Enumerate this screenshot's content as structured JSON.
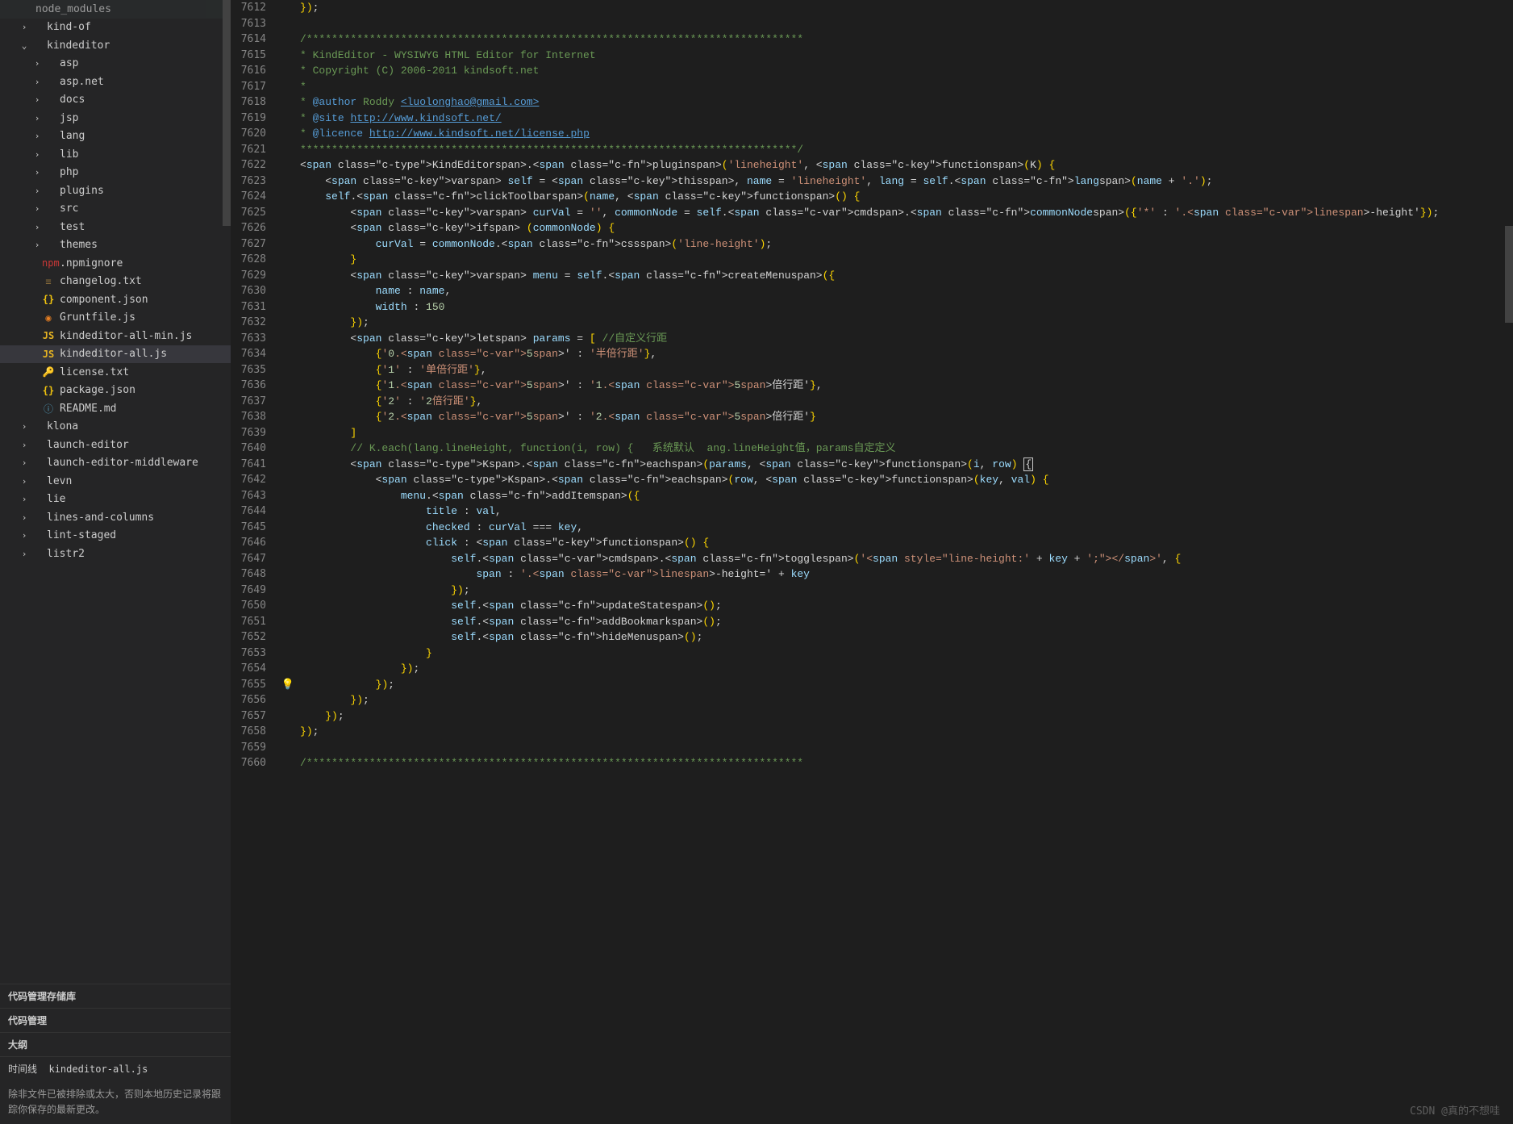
{
  "sidebar": {
    "tree": [
      {
        "indent": 0,
        "chev": "",
        "icon": "",
        "iconClass": "",
        "label": "node_modules",
        "dim": true
      },
      {
        "indent": 1,
        "chev": "›",
        "icon": "",
        "iconClass": "",
        "label": "kind-of"
      },
      {
        "indent": 1,
        "chev": "⌄",
        "icon": "",
        "iconClass": "",
        "label": "kindeditor"
      },
      {
        "indent": 2,
        "chev": "›",
        "icon": "",
        "iconClass": "",
        "label": "asp"
      },
      {
        "indent": 2,
        "chev": "›",
        "icon": "",
        "iconClass": "",
        "label": "asp.net"
      },
      {
        "indent": 2,
        "chev": "›",
        "icon": "",
        "iconClass": "",
        "label": "docs"
      },
      {
        "indent": 2,
        "chev": "›",
        "icon": "",
        "iconClass": "",
        "label": "jsp"
      },
      {
        "indent": 2,
        "chev": "›",
        "icon": "",
        "iconClass": "",
        "label": "lang"
      },
      {
        "indent": 2,
        "chev": "›",
        "icon": "",
        "iconClass": "",
        "label": "lib"
      },
      {
        "indent": 2,
        "chev": "›",
        "icon": "",
        "iconClass": "",
        "label": "php"
      },
      {
        "indent": 2,
        "chev": "›",
        "icon": "",
        "iconClass": "",
        "label": "plugins"
      },
      {
        "indent": 2,
        "chev": "›",
        "icon": "",
        "iconClass": "",
        "label": "src"
      },
      {
        "indent": 2,
        "chev": "›",
        "icon": "",
        "iconClass": "",
        "label": "test"
      },
      {
        "indent": 2,
        "chev": "›",
        "icon": "",
        "iconClass": "",
        "label": "themes"
      },
      {
        "indent": 2,
        "chev": "",
        "icon": "npm",
        "iconClass": "npm",
        "label": ".npmignore"
      },
      {
        "indent": 2,
        "chev": "",
        "icon": "≡",
        "iconClass": "txt",
        "label": "changelog.txt"
      },
      {
        "indent": 2,
        "chev": "",
        "icon": "{}",
        "iconClass": "json",
        "label": "component.json"
      },
      {
        "indent": 2,
        "chev": "",
        "icon": "◉",
        "iconClass": "grunt",
        "label": "Gruntfile.js"
      },
      {
        "indent": 2,
        "chev": "",
        "icon": "JS",
        "iconClass": "js",
        "label": "kindeditor-all-min.js"
      },
      {
        "indent": 2,
        "chev": "",
        "icon": "JS",
        "iconClass": "js",
        "label": "kindeditor-all.js",
        "selected": true
      },
      {
        "indent": 2,
        "chev": "",
        "icon": "🔑",
        "iconClass": "key",
        "label": "license.txt"
      },
      {
        "indent": 2,
        "chev": "",
        "icon": "{}",
        "iconClass": "json",
        "label": "package.json"
      },
      {
        "indent": 2,
        "chev": "",
        "icon": "ⓘ",
        "iconClass": "readme",
        "label": "README.md"
      },
      {
        "indent": 1,
        "chev": "›",
        "icon": "",
        "iconClass": "",
        "label": "klona"
      },
      {
        "indent": 1,
        "chev": "›",
        "icon": "",
        "iconClass": "",
        "label": "launch-editor"
      },
      {
        "indent": 1,
        "chev": "›",
        "icon": "",
        "iconClass": "",
        "label": "launch-editor-middleware"
      },
      {
        "indent": 1,
        "chev": "›",
        "icon": "",
        "iconClass": "",
        "label": "levn"
      },
      {
        "indent": 1,
        "chev": "›",
        "icon": "",
        "iconClass": "",
        "label": "lie"
      },
      {
        "indent": 1,
        "chev": "›",
        "icon": "",
        "iconClass": "",
        "label": "lines-and-columns"
      },
      {
        "indent": 1,
        "chev": "›",
        "icon": "",
        "iconClass": "",
        "label": "lint-staged"
      },
      {
        "indent": 1,
        "chev": "›",
        "icon": "",
        "iconClass": "",
        "label": "listr2"
      }
    ],
    "sections": {
      "srcRepo": "代码管理存储库",
      "srcCtrl": "代码管理",
      "outline": "大纲",
      "timeline": "时间线",
      "timelineFile": "kindeditor-all.js"
    },
    "hint": "除非文件已被排除或太大，否则本地历史记录将跟踪你保存的最新更改。"
  },
  "editor": {
    "startLine": 7612,
    "bulbLine": 7655,
    "lines": [
      "});",
      "",
      "/*******************************************************************************",
      "* KindEditor - WYSIWYG HTML Editor for Internet",
      "* Copyright (C) 2006-2011 kindsoft.net",
      "*",
      "* @author Roddy <luolonghao@gmail.com>",
      "* @site http://www.kindsoft.net/",
      "* @licence http://www.kindsoft.net/license.php",
      "*******************************************************************************/",
      "KindEditor.plugin('lineheight', function(K) {",
      "    var self = this, name = 'lineheight', lang = self.lang(name + '.');",
      "    self.clickToolbar(name, function() {",
      "        var curVal = '', commonNode = self.cmd.commonNode({'*' : '.line-height'});",
      "        if (commonNode) {",
      "            curVal = commonNode.css('line-height');",
      "        }",
      "        var menu = self.createMenu({",
      "            name : name,",
      "            width : 150",
      "        });",
      "        let params = [ //自定义行距",
      "            {'0.5' : '半倍行距'},",
      "            {'1' : '单倍行距'},",
      "            {'1.5' : '1.5倍行距'},",
      "            {'2' : '2倍行距'},",
      "            {'2.5' : '2.5倍行距'}",
      "        ]",
      "        // K.each(lang.lineHeight, function(i, row) {   系统默认  ang.lineHeight值，params自定定义",
      "        K.each(params, function(i, row) {",
      "            K.each(row, function(key, val) {",
      "                menu.addItem({",
      "                    title : val,",
      "                    checked : curVal === key,",
      "                    click : function() {",
      "                        self.cmd.toggle('<span style=\"line-height:' + key + ';\"></span>', {",
      "                            span : '.line-height=' + key",
      "                        });",
      "                        self.updateState();",
      "                        self.addBookmark();",
      "                        self.hideMenu();",
      "                    }",
      "                });",
      "            });",
      "        });",
      "    });",
      "});",
      "",
      "/*******************************************************************************"
    ]
  },
  "watermark": "CSDN @真的不想哇"
}
